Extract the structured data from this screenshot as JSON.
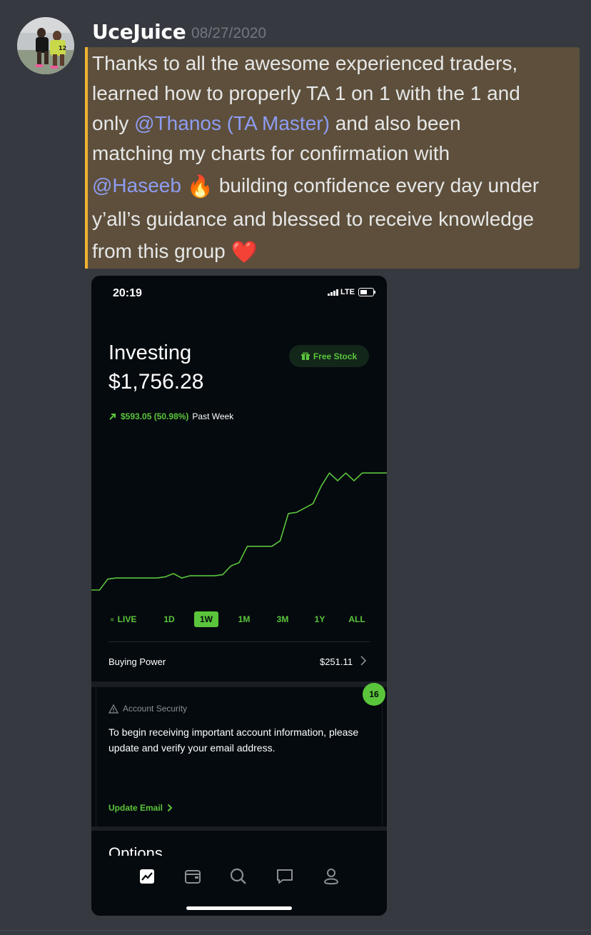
{
  "message": {
    "username": "UceJuice",
    "timestamp": "08/27/2020",
    "line1": "Thanks to all the awesome experienced traders,",
    "line2": "learned how to properly TA 1 on 1 with the 1 and",
    "line3_pre": "only ",
    "mention1": "@Thanos (TA Master)",
    "line3_post": " and also been",
    "line4": "matching my charts for confirmation with",
    "mention2": "@Haseeb",
    "emoji_fire": "🔥",
    "line5_post": " building confidence every day under",
    "line6": "y’all’s guidance and blessed to receive knowledge",
    "line7": "from this group ",
    "emoji_heart": "❤️",
    "colors": {
      "highlight": "#5d4f3b",
      "highlight_border": "#f0b232",
      "mention": "#8e9cf2"
    }
  },
  "phone": {
    "status": {
      "time": "20:19",
      "network": "LTE"
    },
    "header": {
      "title": "Investing",
      "value": "$1,756.28",
      "free_stock": "Free Stock",
      "free_stock_icon": "gift-icon"
    },
    "gain": {
      "amount": "$593.05 (50.98%)",
      "period": "Past Week",
      "icon": "arrow-up-right-icon"
    },
    "chart_data": {
      "type": "line",
      "x": [
        0,
        1,
        2,
        3,
        4,
        5,
        6,
        7,
        8,
        9,
        10,
        11,
        12,
        13,
        14,
        15,
        16,
        17,
        18,
        19,
        20,
        21,
        22,
        23,
        24,
        25,
        26,
        27,
        28,
        29,
        30,
        31,
        32,
        33,
        34,
        35,
        36
      ],
      "values": [
        0,
        0,
        20,
        22,
        22,
        22,
        22,
        22,
        22,
        24,
        30,
        22,
        26,
        26,
        26,
        26,
        28,
        44,
        50,
        80,
        80,
        80,
        80,
        90,
        140,
        142,
        150,
        158,
        190,
        214,
        200,
        214,
        200,
        214,
        214,
        214,
        214
      ],
      "ylim": [
        0,
        230
      ],
      "grid": false,
      "color": "#5ac53b"
    },
    "ranges": [
      "LIVE",
      "1D",
      "1W",
      "1M",
      "3M",
      "1Y",
      "ALL"
    ],
    "selected_range": "1W",
    "buying_power": {
      "label": "Buying Power",
      "value": "$251.11"
    },
    "badge": "16",
    "security": {
      "title": "Account Security",
      "body": "To begin receiving important account information, please update and verify your email address.",
      "link": "Update Email"
    },
    "options_label": "Options",
    "tabs": [
      "chart-icon",
      "wallet-icon",
      "search-icon",
      "messages-icon",
      "account-icon"
    ],
    "colors": {
      "accent": "#5ac53b",
      "background": "#050a0e"
    }
  }
}
